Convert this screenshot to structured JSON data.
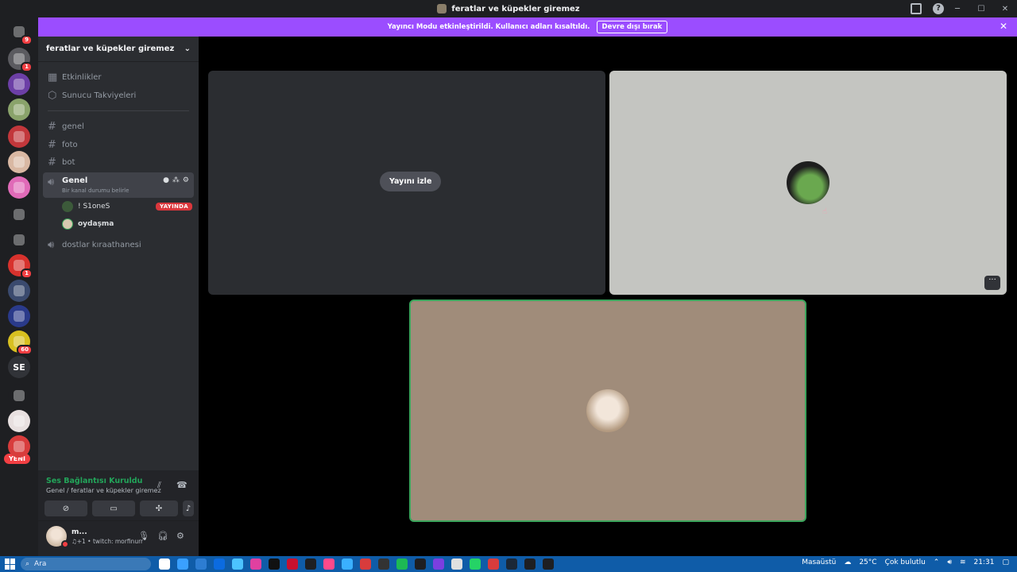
{
  "window": {
    "title": "feratlar ve küpekler giremez",
    "controls": [
      "─",
      "☐",
      "✕"
    ]
  },
  "banner": {
    "message": "Yayıncı Modu etkinleştirildi. Kullanıcı adları kısaltıldı.",
    "button": "Devre dışı bırak",
    "close": "✕"
  },
  "guilds": [
    {
      "name": "discord-home",
      "color": "#1e1f22",
      "badge": "9"
    },
    {
      "name": "server-1",
      "color": "#5b5b60",
      "badge": "1"
    },
    {
      "name": "server-2",
      "color": "#6c3fa6",
      "badge": ""
    },
    {
      "name": "server-3",
      "color": "#8aa36b",
      "badge": ""
    },
    {
      "name": "server-4",
      "color": "#c2373b",
      "badge": ""
    },
    {
      "name": "server-5",
      "color": "#d9b8a3",
      "badge": ""
    },
    {
      "name": "server-6",
      "color": "#e06bb8",
      "badge": ""
    },
    {
      "name": "server-7",
      "color": "#1e1f22",
      "badge": ""
    },
    {
      "name": "server-8",
      "color": "#1e1f22",
      "badge": ""
    },
    {
      "name": "server-9",
      "color": "#d8322d",
      "badge": "1"
    },
    {
      "name": "server-10",
      "color": "#3a4a6e",
      "badge": ""
    },
    {
      "name": "server-11",
      "color": "#2a3a8a",
      "badge": ""
    },
    {
      "name": "server-12",
      "color": "#d8c020",
      "badge": "60"
    },
    {
      "name": "server-se",
      "color": "#313338",
      "badge": "",
      "text": "SE"
    },
    {
      "name": "server-14",
      "color": "#1e1f22",
      "badge": ""
    },
    {
      "name": "server-15",
      "color": "#e8e0e0",
      "badge": ""
    },
    {
      "name": "server-16",
      "color": "#d83c3c",
      "badge": ""
    }
  ],
  "new_badge": "YENİ",
  "server": {
    "name": "feratlar ve küpekler giremez",
    "menu": [
      {
        "label": "Etkinlikler"
      },
      {
        "label": "Sunucu Takviyeleri"
      }
    ],
    "channels": [
      {
        "label": "genel",
        "kind": "text"
      },
      {
        "label": "foto",
        "kind": "text"
      },
      {
        "label": "bot",
        "kind": "text"
      }
    ],
    "voice_active": {
      "label": "Genel",
      "status_placeholder": "Bir kanal durumu belirle",
      "users": [
        {
          "name": "! S1oneS",
          "badge": "YAYINDA"
        },
        {
          "name": "oydaşma",
          "badge": ""
        }
      ]
    },
    "voice_other": {
      "label": "dostlar kıraathanesi"
    }
  },
  "voice_panel": {
    "status": "Ses Bağlantısı Kuruldu",
    "location": "Genel / feratlar ve küpekler giremez"
  },
  "user_panel": {
    "name": "m...",
    "sub": "♫+1 • twitch: morfinurr"
  },
  "stage": {
    "watch_button": "Yayını izle",
    "more_button": "···"
  },
  "taskbar": {
    "search_placeholder": "Ara",
    "desktop_label": "Masaüstü",
    "weather_temp": "25°C",
    "weather_desc": "Çok bulutlu",
    "time": "21:31",
    "apps": [
      "#ffffff",
      "#3aa0ff",
      "#2d7dd2",
      "#0b6be0",
      "#4cc3ff",
      "#e040a0",
      "#111111",
      "#c8102e",
      "#1e1f22",
      "#ff4a8a",
      "#3ab0ff",
      "#d83c3c",
      "#333333",
      "#1db954",
      "#1e1f22",
      "#7b3fe0",
      "#e0e0e0",
      "#25d366",
      "#d83c3c",
      "#1b2838",
      "#1e1f22",
      "#1e1f22"
    ]
  }
}
